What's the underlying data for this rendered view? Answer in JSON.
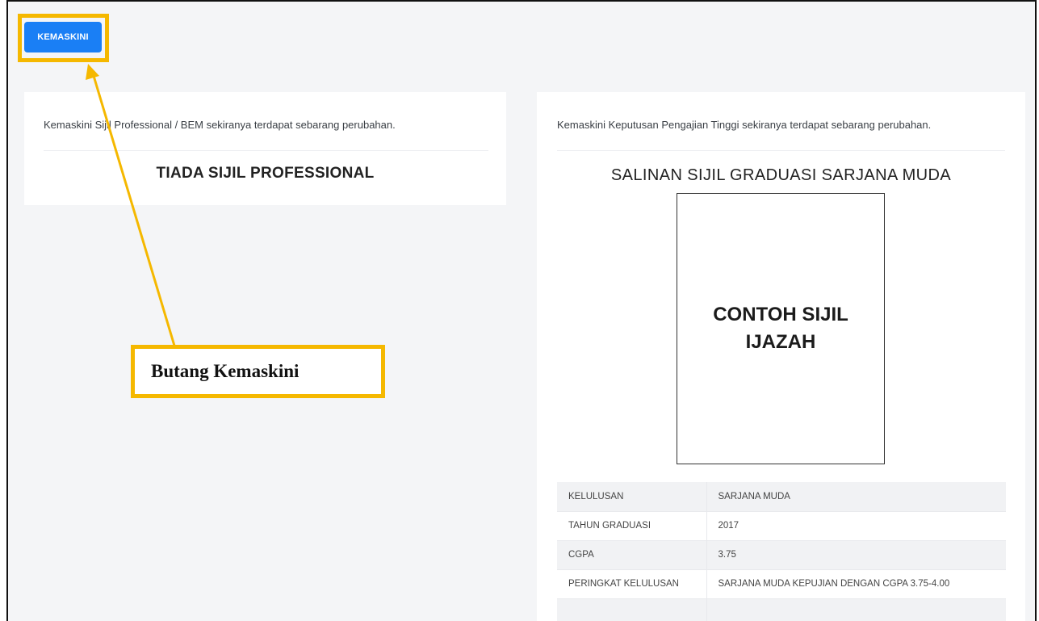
{
  "toolbar": {
    "update_label": "KEMASKINI"
  },
  "left_card": {
    "description": "Kemaskini Sijil Professional / BEM sekiranya terdapat sebarang perubahan.",
    "heading": "TIADA SIJIL PROFESSIONAL"
  },
  "right_card": {
    "description": "Kemaskini Keputusan Pengajian Tinggi sekiranya terdapat sebarang perubahan.",
    "heading": "SALINAN SIJIL GRADUASI SARJANA MUDA",
    "certificate_placeholder": "CONTOH SIJIL\nIJAZAH",
    "table": [
      {
        "key": "KELULUSAN",
        "value": "SARJANA MUDA"
      },
      {
        "key": "TAHUN GRADUASI",
        "value": "2017"
      },
      {
        "key": "CGPA",
        "value": "3.75"
      },
      {
        "key": "PERINGKAT KELULUSAN",
        "value": "SARJANA MUDA KEPUJIAN DENGAN CGPA 3.75-4.00"
      },
      {
        "key": "",
        "value": ""
      }
    ]
  },
  "annotation": {
    "callout_label": "Butang Kemaskini",
    "highlight_color": "#f5b800"
  },
  "colors": {
    "primary_button": "#1a7ff5",
    "page_background": "#f4f5f7"
  }
}
